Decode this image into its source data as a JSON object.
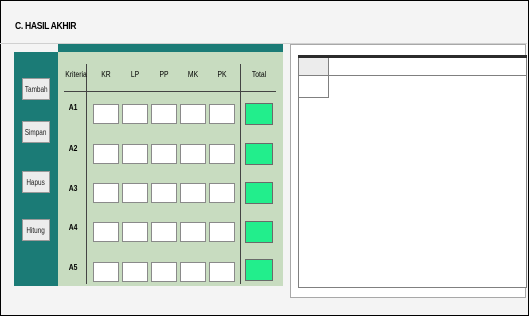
{
  "section_title": "C. HASIL AKHIR",
  "buttons": {
    "tambah": "Tambah",
    "simpan": "Simpan",
    "hapus": "Hapus",
    "hitung": "Hitung"
  },
  "table": {
    "criteria_label": "Kriteria",
    "columns": [
      "KR",
      "LP",
      "PP",
      "MK",
      "PK"
    ],
    "total_label": "Total",
    "rows": [
      "A1",
      "A2",
      "A3",
      "A4",
      "A5"
    ]
  },
  "colors": {
    "sidebar": "#1b7b76",
    "panel": "#c8dcc0",
    "total_fill": "#22ee8c"
  }
}
